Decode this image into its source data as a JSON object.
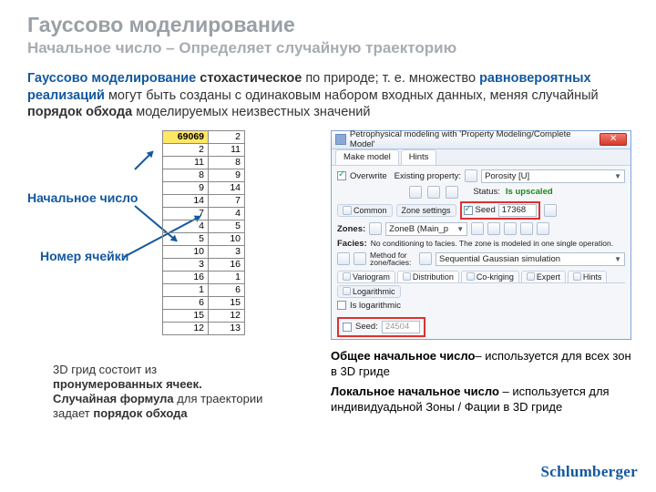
{
  "title": "Гауссово моделирование",
  "subtitle": "Начальное число – Определяет случайную траекторию",
  "intro": {
    "p1a": "Гауссово моделирование",
    "p1b": " стохастическое",
    "p1c": " по природе; т. е. множество ",
    "p1d": "равновероятных реализаций",
    "p1e": " могут быть созданы с одинаковым набором входных данных, меняя случайный ",
    "p1f": "порядок обхода ",
    "p1g": "моделируемых неизвестных значений"
  },
  "labels": {
    "seed": "Начальное число",
    "cell": "Номер ячейки"
  },
  "table": [
    [
      "69069",
      "2"
    ],
    [
      "2",
      "11"
    ],
    [
      "11",
      "8"
    ],
    [
      "8",
      "9"
    ],
    [
      "9",
      "14"
    ],
    [
      "14",
      "7"
    ],
    [
      "7",
      "4"
    ],
    [
      "4",
      "5"
    ],
    [
      "5",
      "10"
    ],
    [
      "10",
      "3"
    ],
    [
      "3",
      "16"
    ],
    [
      "16",
      "1"
    ],
    [
      "1",
      "6"
    ],
    [
      "6",
      "15"
    ],
    [
      "15",
      "12"
    ],
    [
      "12",
      "13"
    ]
  ],
  "caption3d": {
    "a": " 3D грид состоит из ",
    "b": "пронумерованных ячеек. Случайная формула",
    "c": " для траектории задает ",
    "d": "порядок обхода"
  },
  "win": {
    "title": "Petrophysical modeling with 'Property Modeling/Complete Model'",
    "tabs": [
      "Make model",
      "Hints"
    ],
    "overwrite": "Overwrite",
    "existing": "Existing property:",
    "prop": "Porosity [U]",
    "statusLabel": "Status:",
    "statusVal": "Is upscaled",
    "pillCommon": "Common",
    "pillZone": "Zone settings",
    "seedLabel": "Seed",
    "seedVal": "17368",
    "zones": "Zones:",
    "zoneName": "ZoneB (Main_p",
    "facies": "Facies:",
    "faciesMsg": "No conditioning to facies. The zone is modeled in one single operation.",
    "methodLabel": "Method for zone/facies:",
    "methodVal": "Sequential Gaussian simulation",
    "subtabs": [
      "Variogram",
      "Distribution",
      "Co-kriging",
      "Expert",
      "Hints"
    ],
    "logTab": "Logarithmic",
    "isLog": "Is logarithmic",
    "localSeedLabel": "Seed:",
    "localSeedVal": "24504"
  },
  "notes": {
    "n1a": "Общее начальное число",
    "n1b": "– используется для всех зон в 3D гриде",
    "n2a": "Локальное начальное число",
    "n2b": " – используется для индивидуадьной Зоны / Фации в 3D гриде"
  },
  "logo": "Schlumberger"
}
